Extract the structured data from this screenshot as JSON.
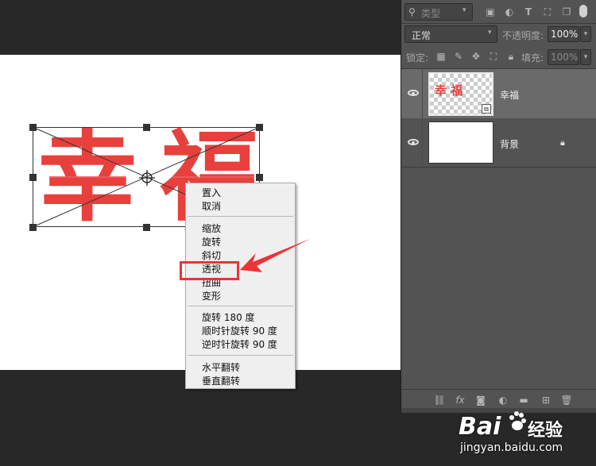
{
  "canvas": {
    "layer_text": "幸福",
    "text_color": "#e8403c"
  },
  "context_menu": {
    "items": [
      "置入",
      "取消",
      "缩放",
      "旋转",
      "斜切",
      "透视",
      "扭曲",
      "变形",
      "旋转 180 度",
      "顺时针旋转 90 度",
      "逆时针旋转 90 度",
      "水平翻转",
      "垂直翻转"
    ],
    "highlighted_item": "透视",
    "highlight_color": "#ec3337"
  },
  "layers_panel": {
    "filter": {
      "label": "类型"
    },
    "blend_mode": "正常",
    "opacity_label": "不透明度:",
    "opacity_value": "100%",
    "lock_label": "锁定:",
    "fill_label": "填充:",
    "fill_value": "100%",
    "layers": [
      {
        "name": "幸福",
        "thumb_text": "幸 福",
        "selected": true,
        "visible": true,
        "smart_object": true
      },
      {
        "name": "背景",
        "selected": false,
        "visible": true,
        "locked": true
      }
    ],
    "bottom_icons": [
      "link-icon",
      "fx-icon",
      "mask-icon",
      "adjustment-icon",
      "folder-icon",
      "new-layer-icon",
      "trash-icon"
    ],
    "fx_label": "fx"
  },
  "watermark": {
    "brand": "Bai",
    "brand_suffix": "经验",
    "url": "jingyan.baidu.com"
  }
}
